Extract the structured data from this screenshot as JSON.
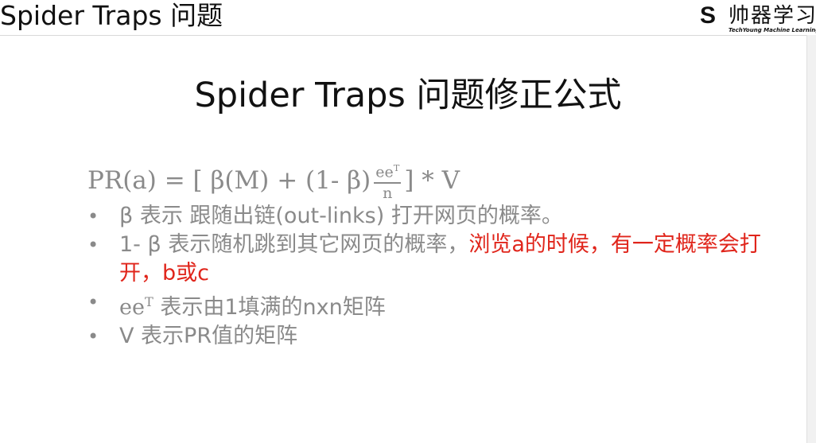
{
  "header": {
    "title": "Spider Traps 问题",
    "brand_logo": "S",
    "brand_name": "帅器学习",
    "brand_sub": "TechYoung Machine Learning"
  },
  "slide": {
    "heading": "Spider Traps 问题修正公式",
    "formula": {
      "left": "PR(a) = [ β(M) +  (1- β)",
      "frac_num": "ee",
      "frac_num_sup": "T",
      "frac_den": "n",
      "right": " ] * V"
    },
    "bullets": [
      {
        "marker": "•",
        "text": "β 表示 跟随出链(out-links) 打开网页的概率。"
      },
      {
        "marker": "•",
        "text": "1- β 表示随机跳到其它网页的概率，",
        "highlight": "浏览a的时候，有一定概率会打开，b或c"
      },
      {
        "marker": "•",
        "prefix": "ee",
        "prefix_sup": "T",
        "text": " 表示由1填满的nxn矩阵"
      },
      {
        "marker": "•",
        "text": "V 表示PR值的矩阵"
      }
    ]
  },
  "colors": {
    "text_gray": "#8a8a8a",
    "highlight_red": "#e0251b",
    "title_black": "#111111"
  }
}
